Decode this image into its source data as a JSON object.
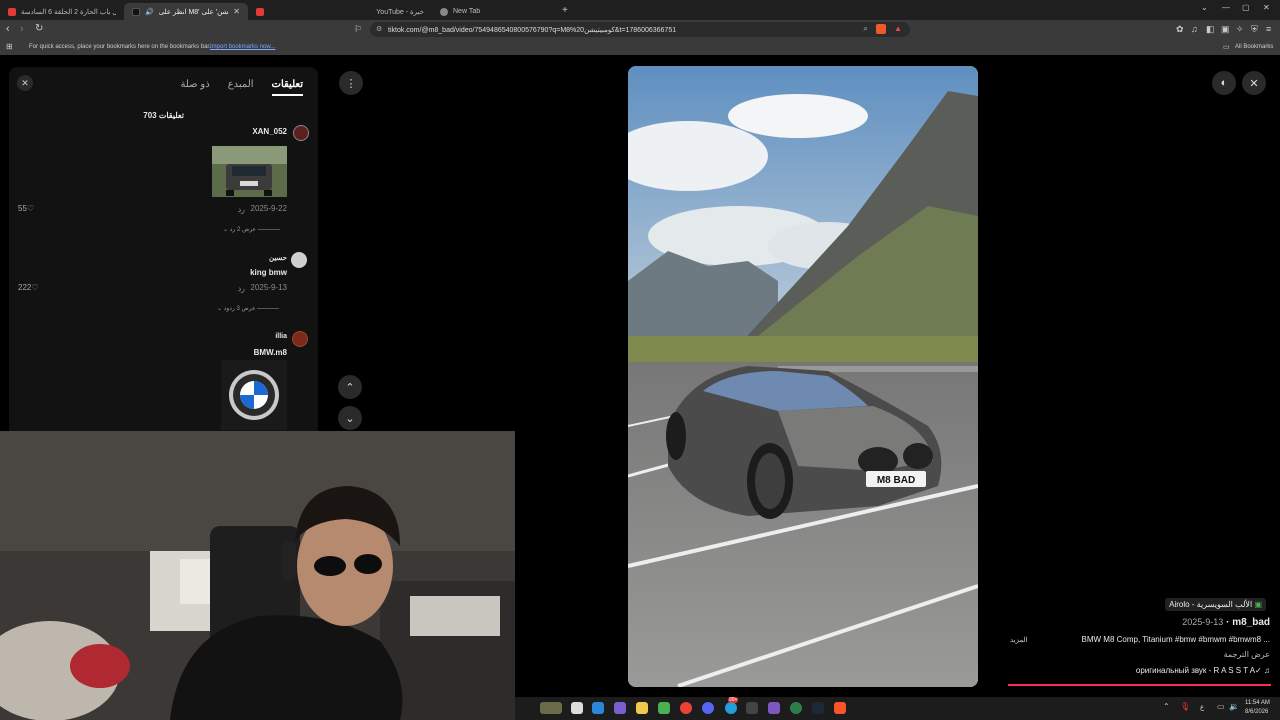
{
  "browser": {
    "tabs": [
      {
        "title": "مسلسل باب الحارة 2 الحلقة 6 السادسة",
        "active": false,
        "color": "#e53935"
      },
      {
        "title": "انظر على M8' كومبتيشن' على",
        "active": true,
        "color": "#111111"
      },
      {
        "title": "",
        "active": false,
        "color": "#e53935"
      },
      {
        "title": "YouTube - خيرة",
        "active": false,
        "color": "#1f1f1f"
      },
      {
        "title": "New Tab",
        "active": false,
        "color": "#888888"
      }
    ],
    "url": "tiktok.com/@m8_bad/video/7549486540800576790?q=M8%20كومبيتيشن&t=1786006366751",
    "bookmarks_hint": "For quick access, place your bookmarks here on the bookmarks bar.",
    "bookmarks_import": "Import bookmarks now...",
    "all_bookmarks": "All Bookmarks"
  },
  "comments_panel": {
    "tabs": [
      "تعليقات",
      "المبدع",
      "ذو صلة"
    ],
    "count_label": "703 تعليقات",
    "comments": [
      {
        "user": "XAN_052",
        "text": "",
        "date": "2025-9-22",
        "reply": "رد",
        "likes": "55",
        "view_replies": "عرض 2 رد"
      },
      {
        "user": "حسين",
        "text": "king bmw",
        "date": "2025-9-13",
        "reply": "رد",
        "likes": "222",
        "view_replies": "عرض 3 ردود"
      },
      {
        "user": "illia",
        "text": "BMW.m8",
        "date": "",
        "reply": "",
        "likes": "",
        "view_replies": ""
      }
    ]
  },
  "video_info": {
    "location": "Airolo - الألب السويسرية",
    "author": "m8_bad",
    "date": "2025-9-13",
    "caption": "BMW M8 Comp, Titanium #bmw #bmwm #bmwm8 ...",
    "more": "المزيد",
    "translate": "عرض الترجمة",
    "sound": "оригинальный звук - R A S S T A✓"
  },
  "plate_text": "M8 BAD",
  "taskbar": {
    "time": "11:54 AM",
    "date": "8/6/2026",
    "lang": "ع",
    "badge": "99+"
  }
}
